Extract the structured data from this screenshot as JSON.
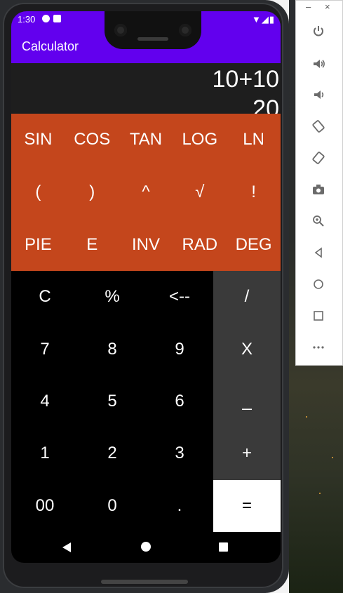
{
  "status_bar": {
    "time": "1:30"
  },
  "app": {
    "title": "Calculator"
  },
  "display": {
    "expression": "10+10",
    "result": "20"
  },
  "scientific_keys": [
    "SIN",
    "COS",
    "TAN",
    "LOG",
    "LN",
    "(",
    ")",
    "^",
    "√",
    "!",
    "PIE",
    "E",
    "INV",
    "RAD",
    "DEG"
  ],
  "basic_keys": [
    "C",
    "%",
    "<--",
    "/",
    "7",
    "8",
    "9",
    "X",
    "4",
    "5",
    "6",
    "_",
    "1",
    "2",
    "3",
    "+",
    "00",
    "0",
    ".",
    "="
  ],
  "colors": {
    "app_bar": "#6200ee",
    "scientific_panel": "#c4461c",
    "operator_column": "#3a3a3a",
    "keypad": "#000000",
    "equals": "#ffffff"
  },
  "emulator_toolbar": {
    "window_controls": [
      "minimize-icon",
      "close-icon"
    ],
    "buttons": [
      "power-icon",
      "volume-up-icon",
      "volume-down-icon",
      "rotate-left-icon",
      "rotate-right-icon",
      "camera-icon",
      "zoom-icon",
      "back-icon",
      "home-icon",
      "overview-icon",
      "more-icon"
    ]
  },
  "window_controls_glyphs": {
    "minimize": "–",
    "close": "×"
  },
  "navigation": {
    "items": [
      "back",
      "home",
      "recents"
    ]
  }
}
